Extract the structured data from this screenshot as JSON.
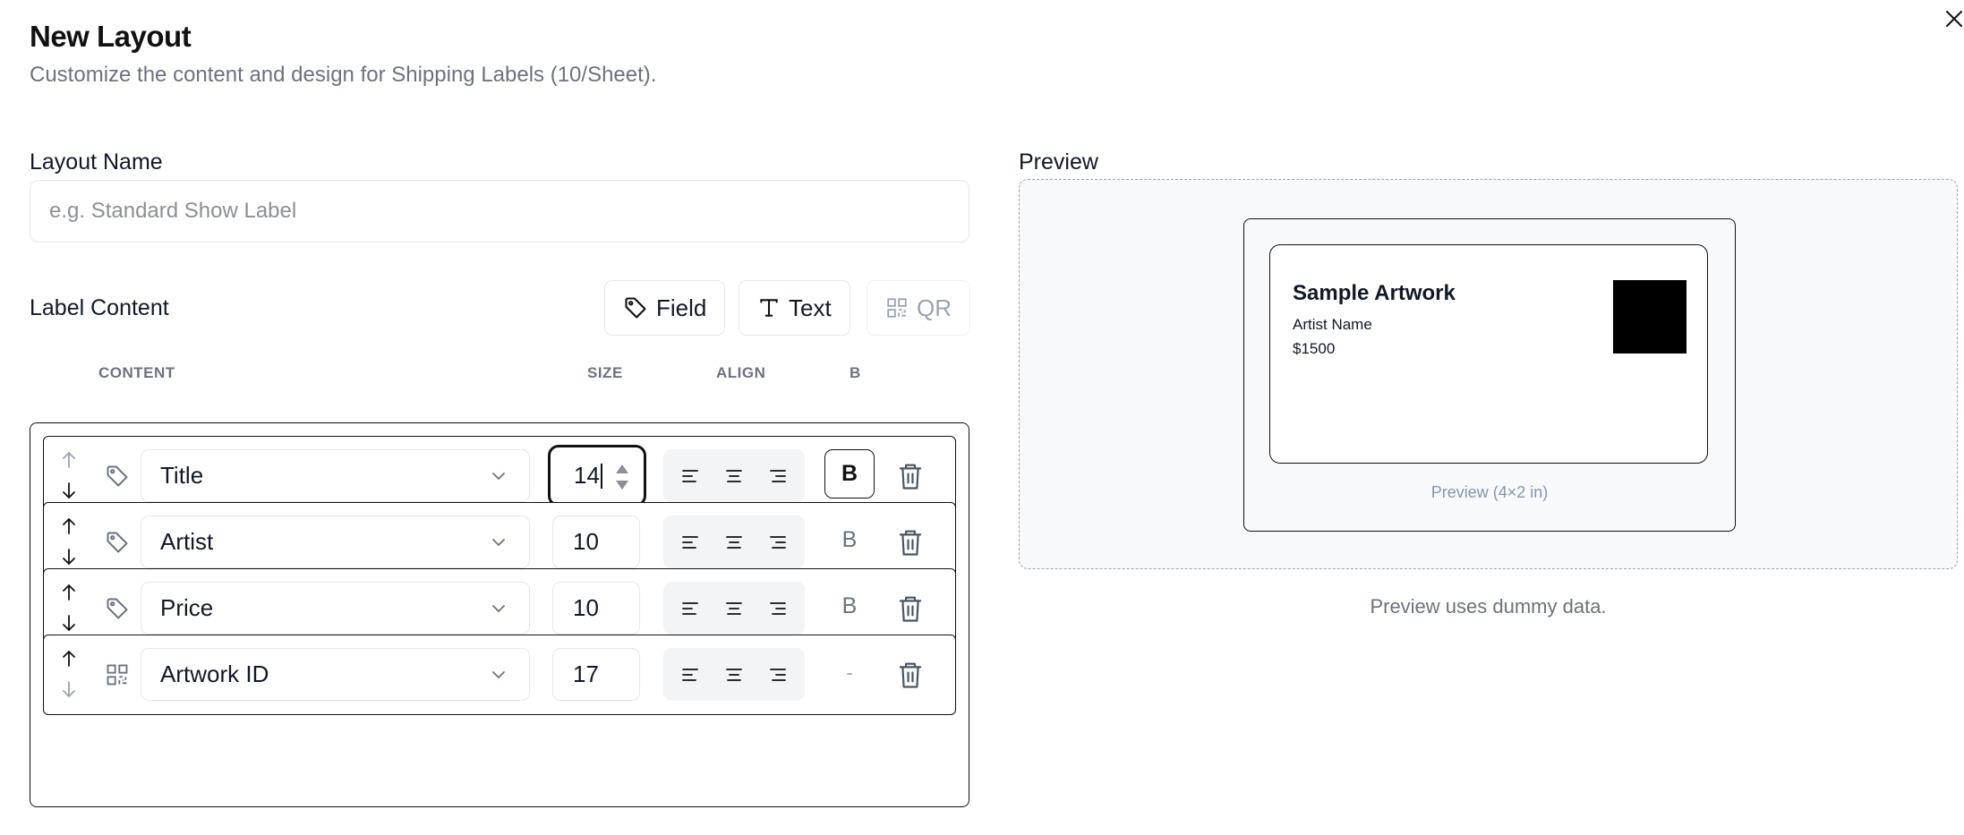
{
  "dialog": {
    "title": "New Layout",
    "subtitle": "Customize the content and design for Shipping Labels (10/Sheet)."
  },
  "layout_name": {
    "label": "Layout Name",
    "value": "",
    "placeholder": "e.g. Standard Show Label"
  },
  "label_content": {
    "heading": "Label Content",
    "add_buttons": [
      {
        "label": "Field",
        "icon": "tag-icon",
        "enabled": true
      },
      {
        "label": "Text",
        "icon": "text-icon",
        "enabled": true
      },
      {
        "label": "QR",
        "icon": "qr-code-icon",
        "enabled": false
      }
    ],
    "columns": {
      "content": "CONTENT",
      "size": "SIZE",
      "align": "ALIGN",
      "bold": "B"
    },
    "rows": [
      {
        "type": "field",
        "type_icon": "tag-icon",
        "content": "Title",
        "size": "14",
        "size_focused": true,
        "bold": "B",
        "bold_active": true,
        "move_up_enabled": false,
        "move_down_enabled": true
      },
      {
        "type": "field",
        "type_icon": "tag-icon",
        "content": "Artist",
        "size": "10",
        "bold": "B",
        "bold_active": false,
        "move_up_enabled": true,
        "move_down_enabled": true
      },
      {
        "type": "field",
        "type_icon": "tag-icon",
        "content": "Price",
        "size": "10",
        "bold": "B",
        "bold_active": false,
        "move_up_enabled": true,
        "move_down_enabled": true
      },
      {
        "type": "qr",
        "type_icon": "qr-code-icon",
        "content": "Artwork ID",
        "size": "17",
        "bold": "-",
        "bold_active": false,
        "move_up_enabled": true,
        "move_down_enabled": false
      }
    ]
  },
  "preview": {
    "heading": "Preview",
    "card": {
      "title": "Sample Artwork",
      "artist": "Artist Name",
      "price": "$1500"
    },
    "caption": "Preview (4×2 in)",
    "note": "Preview uses dummy data."
  }
}
